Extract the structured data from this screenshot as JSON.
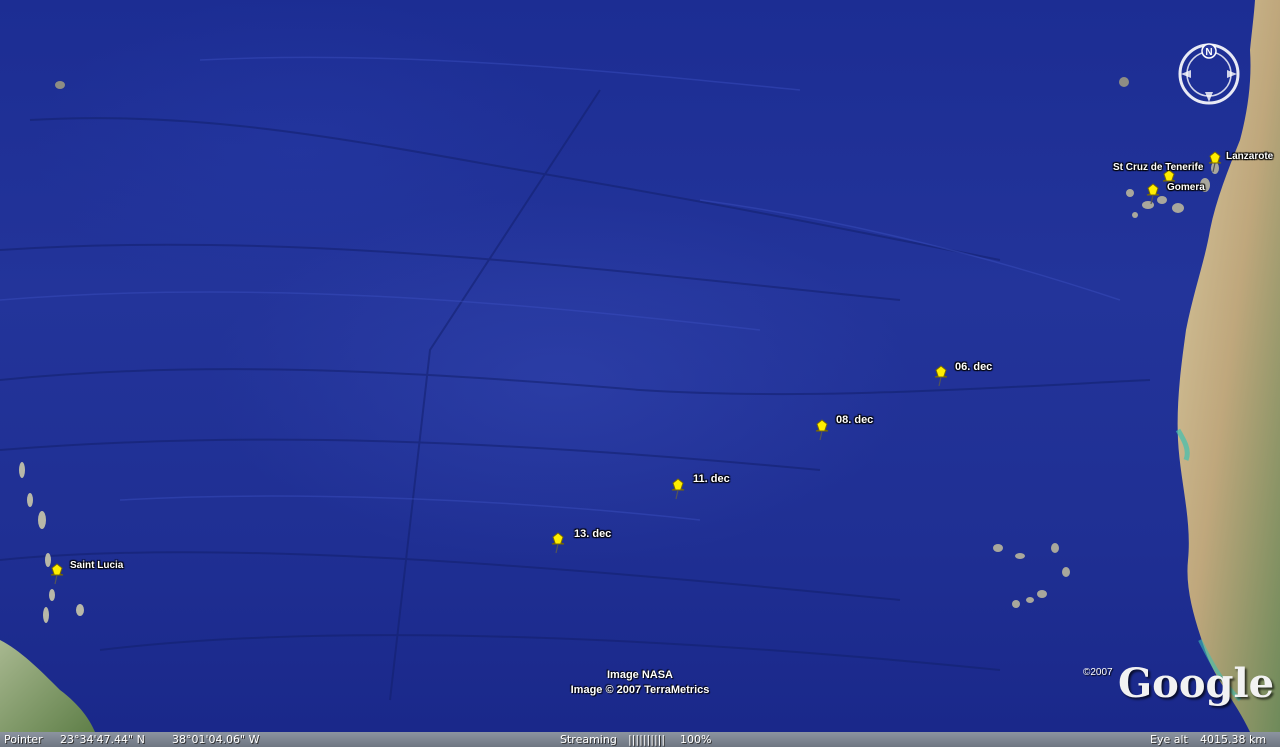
{
  "map": {
    "places": [
      {
        "label": "Lanzarote"
      },
      {
        "label": "St Cruz de Tenerife"
      },
      {
        "label": "Gomera"
      },
      {
        "label": "06. dec"
      },
      {
        "label": "08. dec"
      },
      {
        "label": "11. dec"
      },
      {
        "label": "13. dec"
      },
      {
        "label": "Saint Lucia"
      }
    ],
    "credits": {
      "line1": "Image NASA",
      "line2": "Image © 2007 TerraMetrics"
    },
    "branding": {
      "copyright": "©2007",
      "logo_text": "Google"
    },
    "compass": {
      "north_label": "N"
    }
  },
  "status": {
    "pointer_label": "Pointer",
    "latitude": "23°34'47.44\" N",
    "longitude": "38°01'04.06\" W",
    "streaming_label": "Streaming",
    "streaming_bar": "||||||||||",
    "streaming_percent": "100%",
    "eye_alt_label": "Eye alt",
    "eye_alt_value": "4015.38 km"
  },
  "colors": {
    "ocean": "#1f2f93",
    "land_africa": "#c9b892",
    "land_caribbean": "#8aa06a",
    "pin": "#ffee00",
    "statusbar": "#7a828e"
  },
  "icons": {
    "pin": "yellow-pushpin-icon",
    "compass": "compass-rose-icon"
  }
}
